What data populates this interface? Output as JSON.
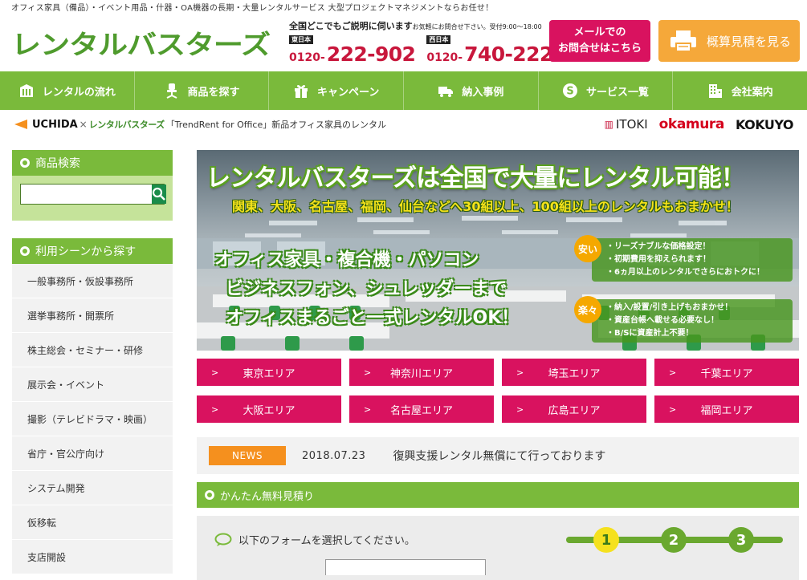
{
  "header": {
    "tagline": "オフィス家具（備品）・イベント用品・什器・OA機器の長期・大量レンタルサービス 大型プロジェクトマネジメントならお任せ！",
    "logo_text": "レンタルバスターズ",
    "contact_lead": "全国どこでもご説明に伺います",
    "contact_note": "お気軽にお問合せ下さい。受付9:00～18:00",
    "phones": [
      {
        "region": "東日本",
        "prefix": "0120-",
        "number": "222-902"
      },
      {
        "region": "西日本",
        "prefix": "0120-",
        "number": "740-222"
      }
    ],
    "mail_button_line1": "メールでの",
    "mail_button_line2": "お問合せはこちら",
    "estimate_button": "概算見積を見る"
  },
  "nav": [
    {
      "label": "レンタルの流れ",
      "icon": "building-icon"
    },
    {
      "label": "商品を探す",
      "icon": "chair-icon"
    },
    {
      "label": "キャンペーン",
      "icon": "gift-icon"
    },
    {
      "label": "納入事例",
      "icon": "truck-icon"
    },
    {
      "label": "サービス一覧",
      "icon": "service-s-icon"
    },
    {
      "label": "会社案内",
      "icon": "office-building-icon"
    }
  ],
  "brand": {
    "uchida": "UCHIDA",
    "cross": "×",
    "mini_logo": "レンタルバスターズ",
    "description": "「TrendRent for Office」新品オフィス家具のレンタル",
    "makers": [
      "ITOKI",
      "okamura",
      "KOKUYO"
    ]
  },
  "sidebar": {
    "search_title": "商品検索",
    "search_placeholder": "",
    "scene_title": "利用シーンから探す",
    "scenes": [
      "一般事務所・仮設事務所",
      "選挙事務所・開票所",
      "株主総会・セミナー・研修",
      "展示会・イベント",
      "撮影（テレビドラマ・映画）",
      "省庁・官公庁向け",
      "システム開発",
      "仮移転",
      "支店開設"
    ]
  },
  "hero": {
    "headline": "レンタルバスターズは全国で大量にレンタル可能！",
    "subheadline": "関東、大阪、名古屋、福岡、仙台などへ30組以上、100組以上のレンタルもおまかせ！",
    "copy": [
      "オフィス家具・複合機・パソコン",
      "ビジネスフォン、シュレッダーまで",
      "オフィスまるごと一式レンタルOK！"
    ],
    "features": [
      {
        "badge": "安い",
        "lines": [
          "・リーズナブルな価格設定！",
          "・初期費用を抑えられます！",
          "・6ヵ月以上のレンタルでさらにおトクに！"
        ]
      },
      {
        "badge": "楽々",
        "lines": [
          "・納入/設置/引き上げもおまかせ！",
          "・資産台帳へ載せる必要なし！",
          "・B/Sに資産計上不要！"
        ]
      }
    ]
  },
  "areas": [
    "東京エリア",
    "神奈川エリア",
    "埼玉エリア",
    "千葉エリア",
    "大阪エリア",
    "名古屋エリア",
    "広島エリア",
    "福岡エリア"
  ],
  "news": {
    "badge": "NEWS",
    "date": "2018.07.23",
    "text": "復興支援レンタル無償にて行っております"
  },
  "quote": {
    "title": "かんたん無料見積り",
    "prompt": "以下のフォームを選択してください。",
    "steps": [
      "1",
      "2",
      "3"
    ],
    "active_step": 1
  },
  "colors": {
    "green": "#7aba3b",
    "pink": "#d9125f",
    "orange": "#f5a83a",
    "phone_red": "#c8173c"
  }
}
